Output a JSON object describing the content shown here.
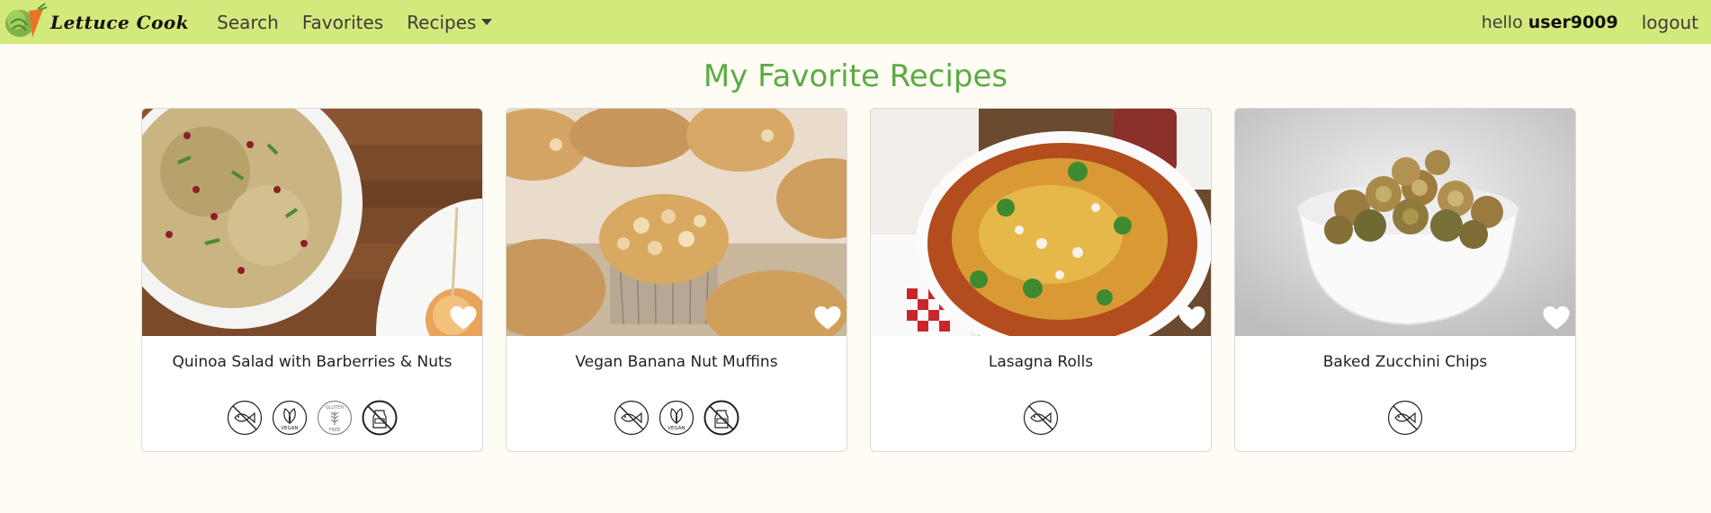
{
  "nav": {
    "brand": "Lettuce Cook",
    "links": [
      "Search",
      "Favorites",
      "Recipes"
    ],
    "greeting_prefix": "hello",
    "username": "user9009",
    "logout": "logout",
    "bg_color": "#d3e97c"
  },
  "page": {
    "title": "My Favorite Recipes",
    "title_color": "#5bab45"
  },
  "recipes": [
    {
      "title": "Quinoa Salad with Barberries & Nuts",
      "image_icon": "quinoa-salad-photo",
      "favorited": true,
      "badges": [
        "no-fish-icon",
        "vegan-icon",
        "gluten-free-icon",
        "no-dairy-icon"
      ],
      "badge_text": {
        "vegan": "VEGAN",
        "gluten_free_top": "GLUTEN",
        "gluten_free_bottom": "FREE"
      }
    },
    {
      "title": "Vegan Banana Nut Muffins",
      "image_icon": "banana-muffins-photo",
      "favorited": true,
      "badges": [
        "no-fish-icon",
        "vegan-icon",
        "no-dairy-icon"
      ],
      "badge_text": {
        "vegan": "VEGAN"
      }
    },
    {
      "title": "Lasagna Rolls",
      "image_icon": "lasagna-photo",
      "favorited": true,
      "badges": [
        "no-fish-icon"
      ]
    },
    {
      "title": "Baked Zucchini Chips",
      "image_icon": "zucchini-chips-photo",
      "favorited": true,
      "badges": [
        "no-fish-icon"
      ]
    }
  ]
}
